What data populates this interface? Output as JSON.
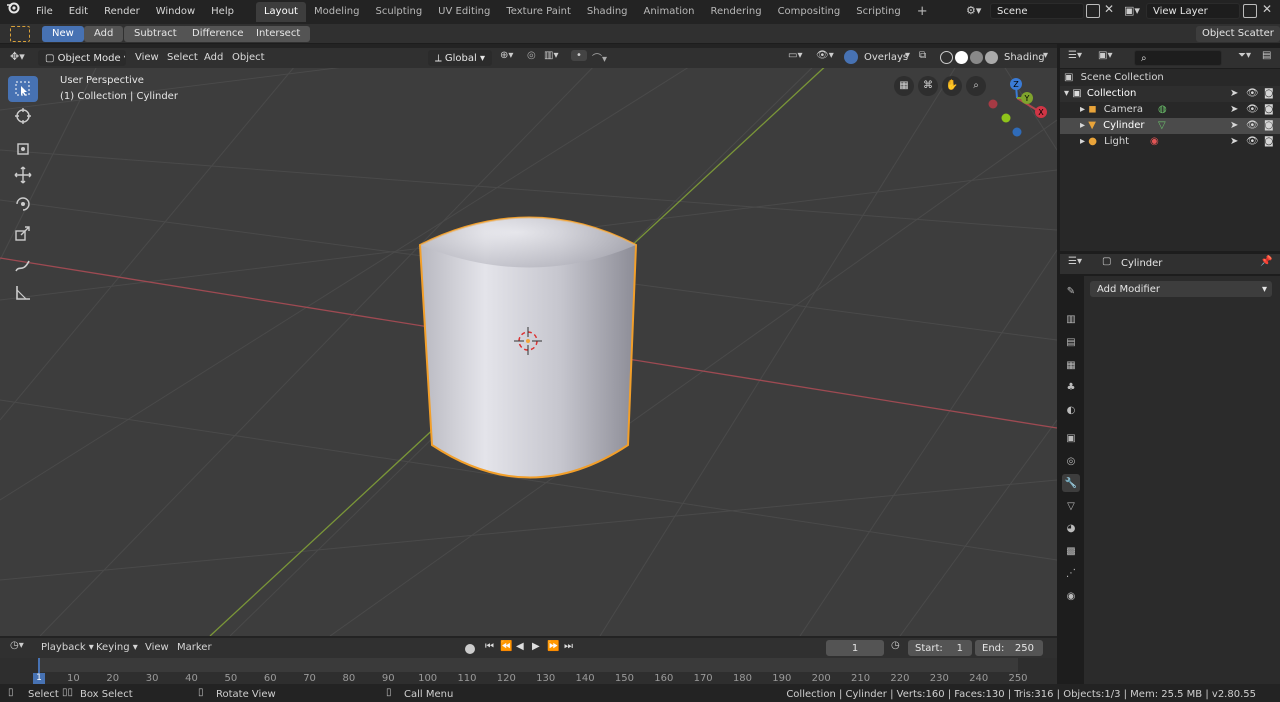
{
  "menu": {
    "file": "File",
    "edit": "Edit",
    "render": "Render",
    "window": "Window",
    "help": "Help"
  },
  "workspaces": [
    "Layout",
    "Modeling",
    "Sculpting",
    "UV Editing",
    "Texture Paint",
    "Shading",
    "Animation",
    "Rendering",
    "Compositing",
    "Scripting"
  ],
  "scene_name": "Scene",
  "view_layer": "View Layer",
  "boolean_bar": {
    "new": "New",
    "add": "Add",
    "subtract": "Subtract",
    "difference": "Difference",
    "intersect": "Intersect",
    "object_scatter": "Object Scatter"
  },
  "viewport_header": {
    "mode": "Object Mode",
    "view": "View",
    "select": "Select",
    "add": "Add",
    "object": "Object",
    "orientation": "Global",
    "overlays": "Overlays",
    "shading": "Shading"
  },
  "viewport": {
    "perspective": "User Perspective",
    "collection_info": "(1) Collection | Cylinder",
    "gizmo_x": "X",
    "gizmo_y": "Y",
    "gizmo_z": "Z"
  },
  "outliner": {
    "scene_collection": "Scene Collection",
    "collection": "Collection",
    "items": [
      "Camera",
      "Cylinder",
      "Light"
    ]
  },
  "properties": {
    "object_name": "Cylinder",
    "add_modifier": "Add Modifier"
  },
  "timeline": {
    "playback": "Playback",
    "keying": "Keying",
    "view": "View",
    "marker": "Marker",
    "current_frame": "1",
    "start_label": "Start:",
    "start_value": "1",
    "end_label": "End:",
    "end_value": "250",
    "ticks": [
      "1",
      "10",
      "20",
      "30",
      "40",
      "50",
      "60",
      "70",
      "80",
      "90",
      "100",
      "110",
      "120",
      "130",
      "140",
      "150",
      "160",
      "170",
      "180",
      "190",
      "200",
      "210",
      "220",
      "230",
      "240",
      "250"
    ]
  },
  "status_bar": {
    "select": "Select",
    "box_select": "Box Select",
    "rotate_view": "Rotate View",
    "call_menu": "Call Menu",
    "stats": "Collection | Cylinder | Verts:160 | Faces:130 | Tris:316 | Objects:1/3 | Mem: 25.5 MB | v2.80.55"
  },
  "colors": {
    "accent": "#4772b3",
    "selection_outline": "#f29f2a",
    "x_axis": "#b3454d",
    "y_axis": "#7fa32d",
    "z_axis": "#3a7bd6"
  }
}
